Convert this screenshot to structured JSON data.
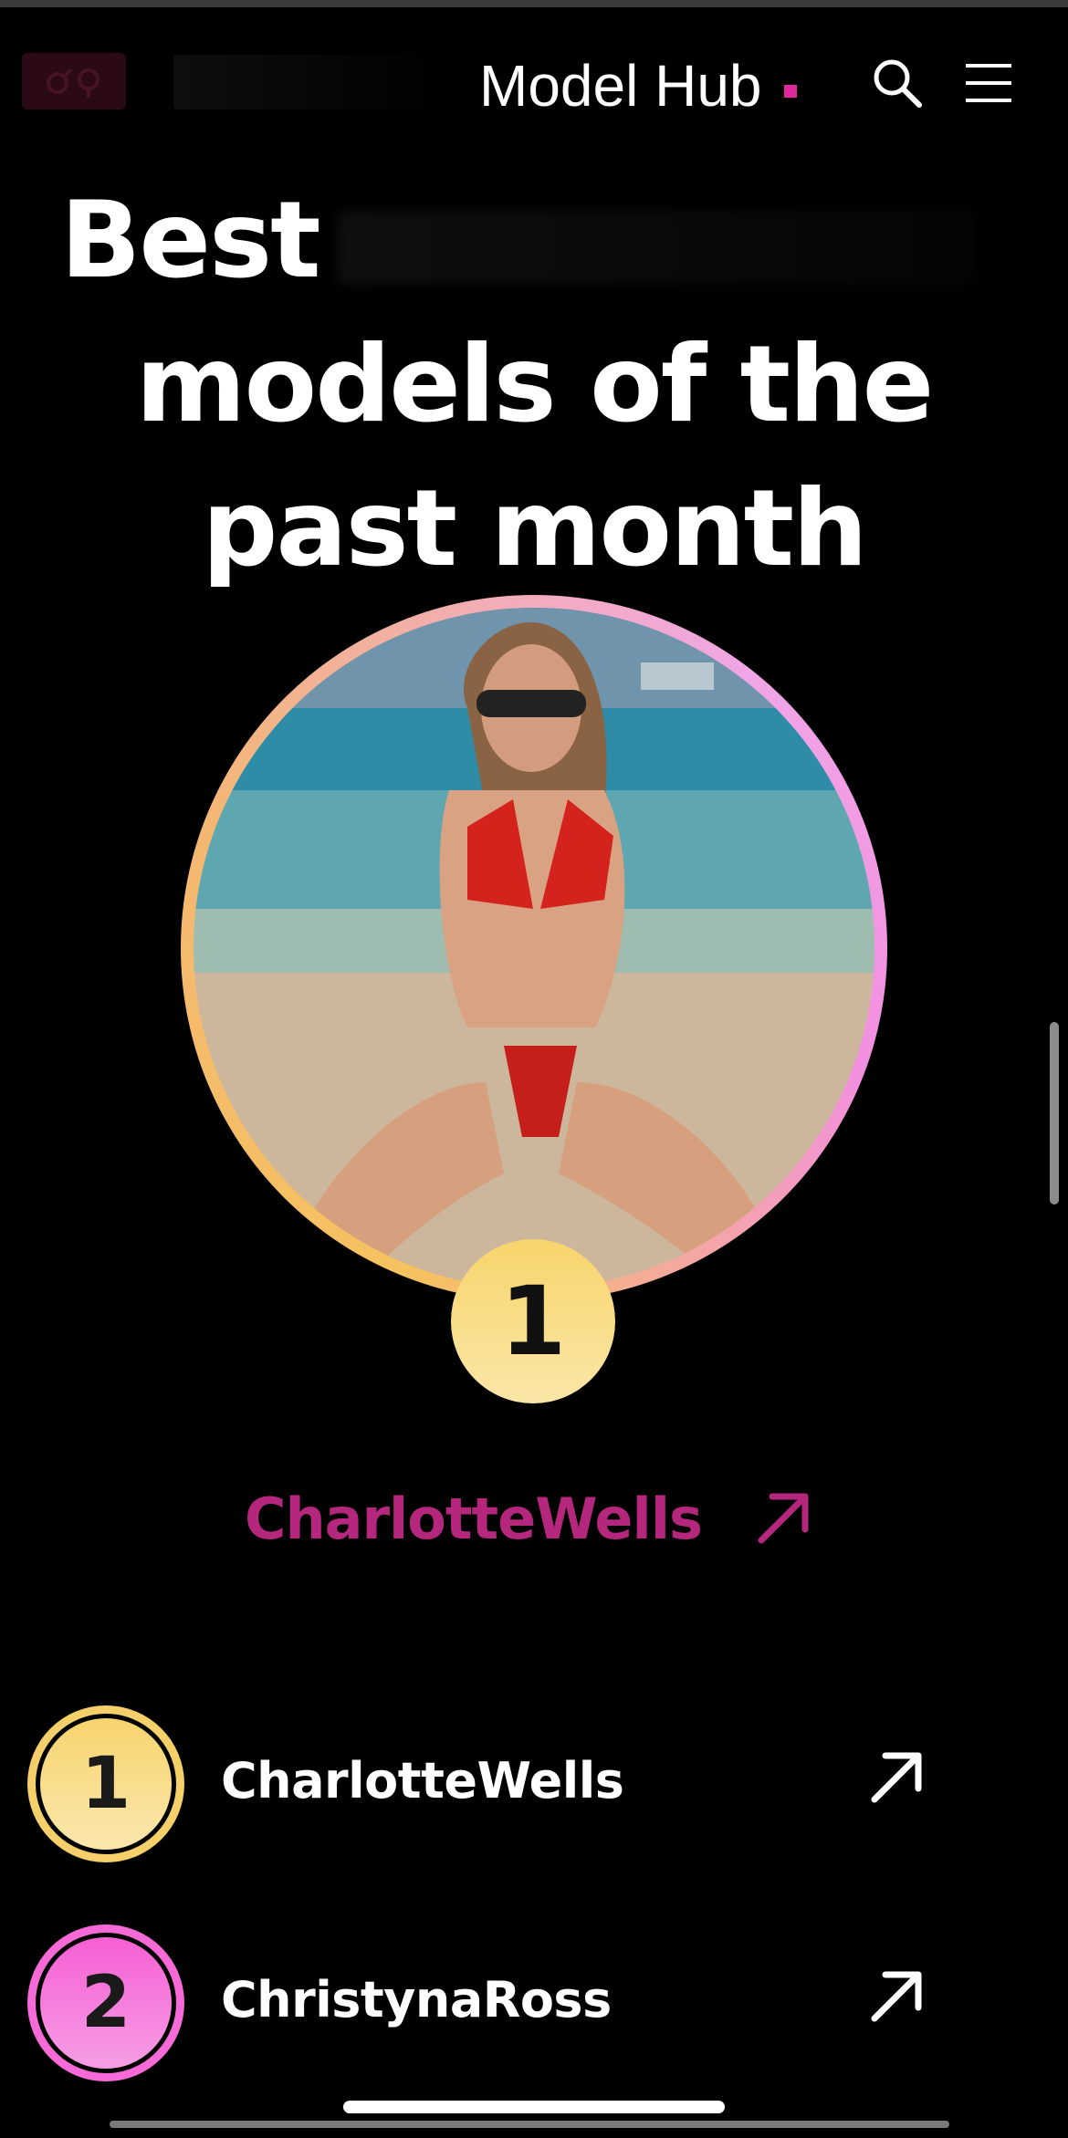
{
  "header": {
    "brand": "Model Hub",
    "accent_color": "#e0279b",
    "icons": [
      "search-icon",
      "menu-icon"
    ]
  },
  "hero": {
    "title_line1": "Best",
    "title_line2": "models of the",
    "title_line3": "past month"
  },
  "featured": {
    "rank": "1",
    "name": "CharlotteWells",
    "name_color": "#b5267d",
    "arrow_icon": "arrow-up-right-icon"
  },
  "list": [
    {
      "rank": "1",
      "name": "CharlotteWells",
      "badge_color": "#f4cf6a"
    },
    {
      "rank": "2",
      "name": "ChristynaRoss",
      "badge_color": "#f56ad6"
    }
  ]
}
